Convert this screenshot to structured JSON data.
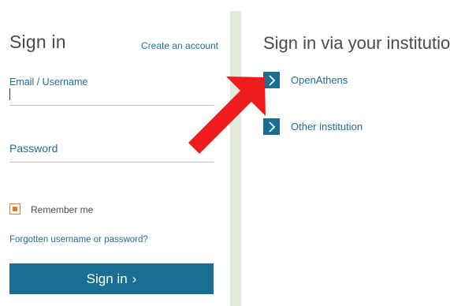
{
  "left": {
    "title": "Sign in",
    "create_account": "Create an account",
    "email_label": "Email / Username",
    "email_value": "",
    "password_label": "Password",
    "password_value": "",
    "remember_label": "Remember me",
    "forgot_link": "Forgotten username or password?",
    "signin_button": "Sign in",
    "signin_chevron": "›"
  },
  "right": {
    "title": "Sign in via your institution",
    "options": [
      {
        "label": "OpenAthens",
        "icon": "chevron-right-icon"
      },
      {
        "label": "Other institution",
        "icon": "chevron-right-icon"
      }
    ]
  },
  "colors": {
    "primary": "#1a6e92",
    "link": "#1f6e92",
    "checkbox": "#e07a2e",
    "arrow": "#ee1c1c",
    "divider": "#e3e9dc",
    "text": "#4a4a4a"
  }
}
